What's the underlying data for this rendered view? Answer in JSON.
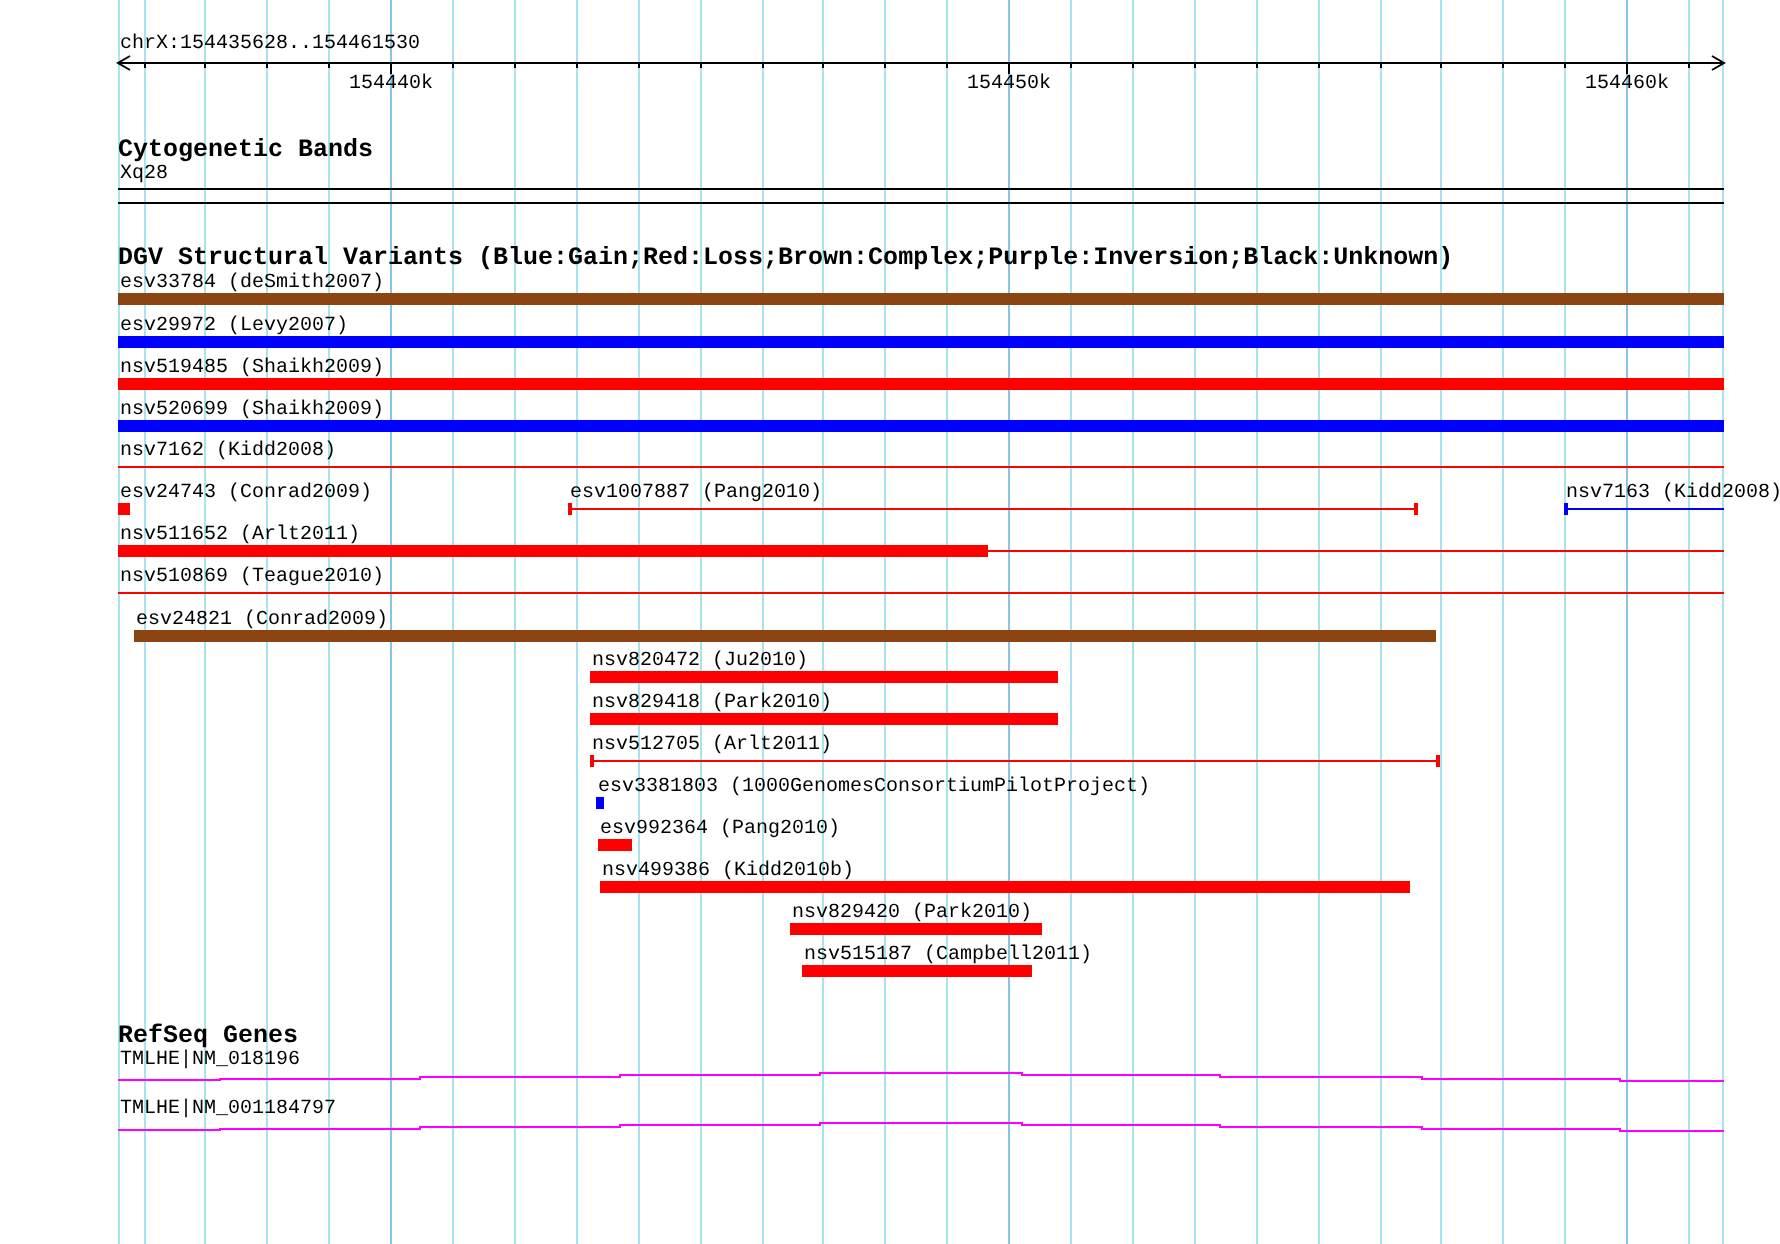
{
  "ruler": {
    "region": "chrX:154435628..154461530",
    "ticks": [
      "154440k",
      "154450k",
      "154460k"
    ]
  },
  "tracks": [
    {
      "kind": "cytoband",
      "title": "Cytogenetic Bands",
      "features": [
        {
          "label": "Xq28"
        }
      ]
    },
    {
      "kind": "variants",
      "title": "DGV Structural Variants (Blue:Gain;Red:Loss;Brown:Complex;Purple:Inversion;Black:Unknown)",
      "features": [
        {
          "label": "esv33784 (deSmith2007)",
          "color": "#8b4513",
          "kind": "bar"
        },
        {
          "label": "esv29972 (Levy2007)",
          "color": "#0000ff",
          "kind": "bar"
        },
        {
          "label": "nsv519485 (Shaikh2009)",
          "color": "#ff0000",
          "kind": "bar"
        },
        {
          "label": "nsv520699 (Shaikh2009)",
          "color": "#0000ff",
          "kind": "bar"
        },
        {
          "label": "nsv7162 (Kidd2008)",
          "color": "#ff0000",
          "kind": "line"
        },
        {
          "label": "esv24743 (Conrad2009)",
          "color": "#ff0000",
          "kind": "bar"
        },
        {
          "label": "esv1007887 (Pang2010)",
          "color": "#ff0000",
          "kind": "span"
        },
        {
          "label": "nsv7163 (Kidd2008)",
          "color": "#0000ff",
          "kind": "span-open"
        },
        {
          "label": "nsv511652 (Arlt2011)",
          "color": "#ff0000",
          "kind": "bar-line"
        },
        {
          "label": "nsv510869 (Teague2010)",
          "color": "#ff0000",
          "kind": "line"
        },
        {
          "label": "esv24821 (Conrad2009)",
          "color": "#8b4513",
          "kind": "bar"
        },
        {
          "label": "nsv820472 (Ju2010)",
          "color": "#ff0000",
          "kind": "bar"
        },
        {
          "label": "nsv829418 (Park2010)",
          "color": "#ff0000",
          "kind": "bar"
        },
        {
          "label": "nsv512705 (Arlt2011)",
          "color": "#ff0000",
          "kind": "span"
        },
        {
          "label": "esv3381803 (1000GenomesConsortiumPilotProject)",
          "color": "#0000ff",
          "kind": "bar"
        },
        {
          "label": "esv992364 (Pang2010)",
          "color": "#ff0000",
          "kind": "bar"
        },
        {
          "label": "nsv499386 (Kidd2010b)",
          "color": "#ff0000",
          "kind": "bar"
        },
        {
          "label": "nsv829420 (Park2010)",
          "color": "#ff0000",
          "kind": "bar"
        },
        {
          "label": "nsv515187 (Campbell2011)",
          "color": "#ff0000",
          "kind": "bar"
        }
      ]
    },
    {
      "kind": "genes",
      "title": "RefSeq Genes",
      "features": [
        {
          "label": "TMLHE|NM_018196"
        },
        {
          "label": "TMLHE|NM_001184797"
        }
      ]
    }
  ]
}
